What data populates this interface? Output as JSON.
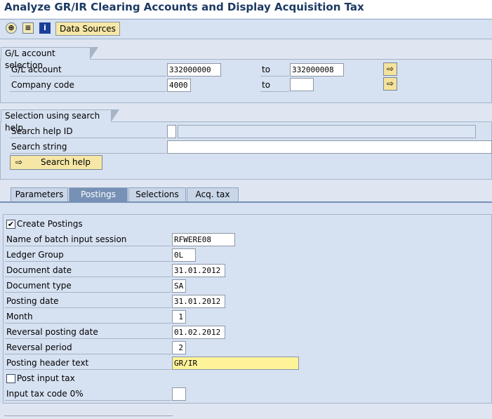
{
  "window": {
    "title": "Analyze GR/IR Clearing Accounts and Display Acquisition Tax"
  },
  "toolbar": {
    "icons": [
      "execute-icon",
      "variant-icon",
      "info-icon"
    ],
    "data_sources_label": "Data Sources"
  },
  "gl_selection": {
    "title": "G/L account selection",
    "gl_account": {
      "label": "G/L account",
      "from": "332000000",
      "to_label": "to",
      "to": "332000008"
    },
    "company_code": {
      "label": "Company code",
      "from": "4000",
      "to_label": "to",
      "to": ""
    },
    "arrow_glyph": "⇨"
  },
  "search_help": {
    "title": "Selection using search help",
    "id_label": "Search help ID",
    "id_value": "",
    "id_desc": "",
    "string_label": "Search string",
    "string_value": "",
    "button_label": "Search help",
    "button_glyph": "⇨"
  },
  "tabs": [
    {
      "label": "Parameters"
    },
    {
      "label": "Postings"
    },
    {
      "label": "Selections"
    },
    {
      "label": "Acq. tax"
    }
  ],
  "active_tab": "Postings",
  "postings": {
    "create_postings": {
      "label": "Create Postings",
      "checked": true,
      "mark": "✔"
    },
    "fields": [
      {
        "label": "Name of batch input session",
        "value": "RFWERE08"
      },
      {
        "label": "Ledger Group",
        "value": "0L"
      },
      {
        "label": "Document date",
        "value": "31.01.2012"
      },
      {
        "label": "Document type",
        "value": "SA"
      },
      {
        "label": "Posting date",
        "value": "31.01.2012"
      },
      {
        "label": "Month",
        "value": "1"
      },
      {
        "label": "Reversal posting date",
        "value": "01.02.2012"
      },
      {
        "label": "Reversal period",
        "value": "2"
      },
      {
        "label": "Posting header text",
        "value": "GR/IR"
      }
    ],
    "post_input_tax": {
      "label": "Post input tax",
      "checked": false
    },
    "input_tax_code": {
      "label": "Input tax code 0%",
      "value": ""
    }
  }
}
